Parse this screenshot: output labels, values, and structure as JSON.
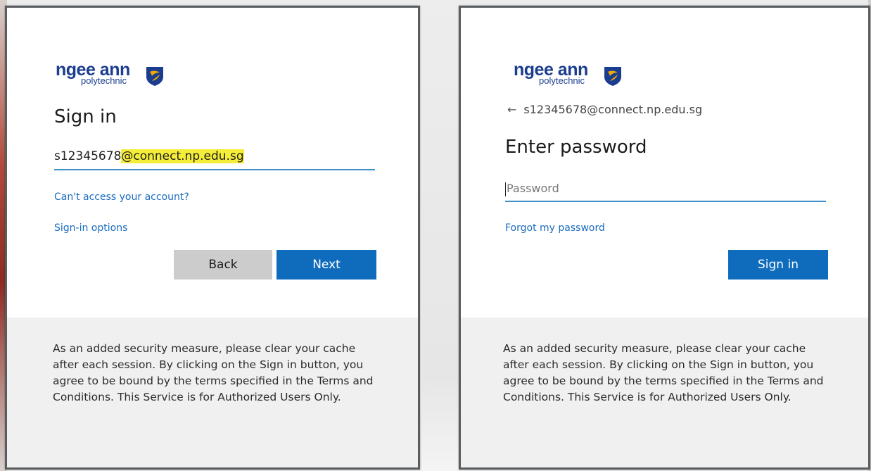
{
  "brand": {
    "name": "ngee ann",
    "subtitle": "polytechnic",
    "shield_color": "#1b3d8f",
    "shield_accent": "#f2a900"
  },
  "signin_card": {
    "heading": "Sign in",
    "email_user": "s12345678",
    "email_domain": "@connect.np.edu.sg",
    "cant_access_link": "Can't access your account?",
    "signin_options_link": "Sign-in options",
    "back_button": "Back",
    "next_button": "Next",
    "footer_text": "As an added security measure, please clear your cache after each session. By clicking on the Sign in button, you agree to be bound by the terms specified in the Terms and Conditions. This Service is for Authorized Users Only."
  },
  "password_card": {
    "back_icon": "left-arrow-icon",
    "email": "s12345678@connect.np.edu.sg",
    "heading": "Enter password",
    "password_placeholder": "Password",
    "forgot_link": "Forgot my password",
    "signin_button": "Sign in",
    "footer_text": "As an added security measure, please clear your cache after each session. By clicking on the Sign in button, you agree to be bound by the terms specified in the Terms and Conditions. This Service is for Authorized Users Only."
  },
  "colors": {
    "accent_blue": "#0f6cbd",
    "link_blue": "#1a6bbf",
    "highlight": "#f5ee39",
    "input_underline": "#3f8fc8"
  }
}
